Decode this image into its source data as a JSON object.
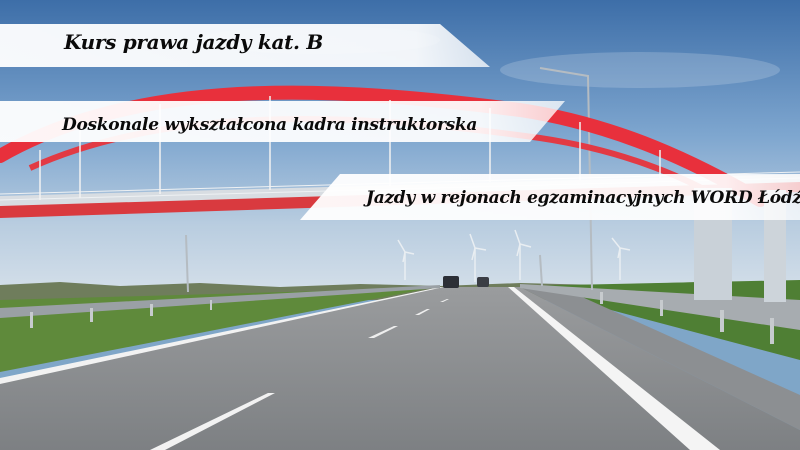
{
  "banners": [
    {
      "text": "Kurs prawa jazdy kat. B"
    },
    {
      "text": "Doskonale wykształcona kadra instruktorska"
    },
    {
      "text": "Jazdy w rejonach egzaminacyjnych WORD Łódź"
    }
  ],
  "colors": {
    "sky_top": "#3f6fa6",
    "sky_bottom": "#c9d8e6",
    "arch": "#e8333f",
    "road": "#8a8d90",
    "grass": "#5e8a3a",
    "banner": "#ffffff"
  }
}
